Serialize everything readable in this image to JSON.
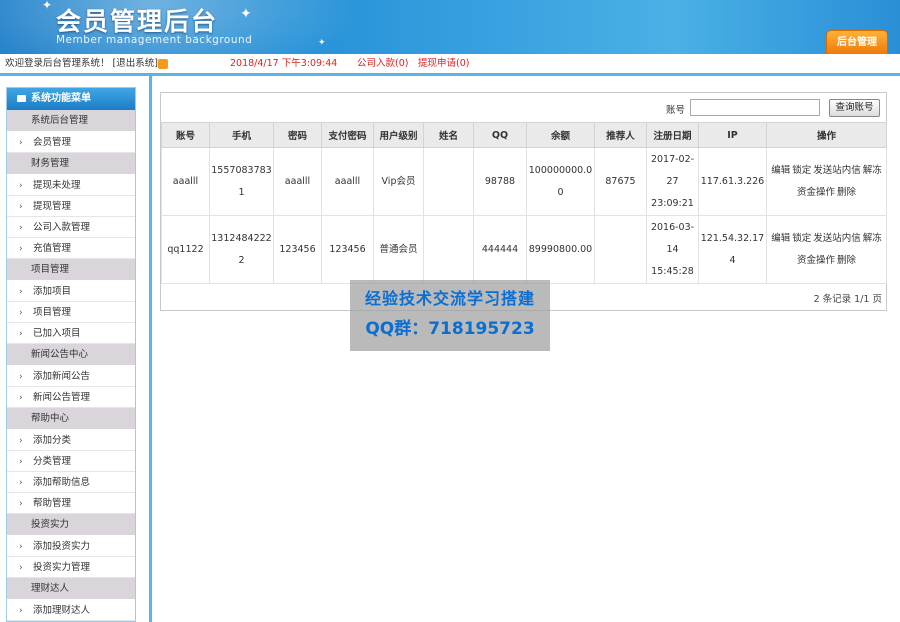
{
  "header": {
    "title": "会员管理后台",
    "subtitle": "Member management background",
    "admin_tab": "后台管理"
  },
  "statusbar": {
    "welcome": "欢迎登录后台管理系统！ [退出系统]",
    "time": "2018/4/17 下午3:09:44",
    "deposits": "公司入款(0)",
    "withdrawals": "提现申请(0)"
  },
  "sidebar": {
    "title": "系统功能菜单",
    "entries": [
      {
        "type": "group",
        "label": "系统后台管理"
      },
      {
        "type": "item",
        "label": "会员管理"
      },
      {
        "type": "group",
        "label": "财务管理"
      },
      {
        "type": "item",
        "label": "提现未处理"
      },
      {
        "type": "item",
        "label": "提现管理"
      },
      {
        "type": "item",
        "label": "公司入款管理"
      },
      {
        "type": "item",
        "label": "充值管理"
      },
      {
        "type": "group",
        "label": "项目管理"
      },
      {
        "type": "item",
        "label": "添加项目"
      },
      {
        "type": "item",
        "label": "项目管理"
      },
      {
        "type": "item",
        "label": "已加入项目"
      },
      {
        "type": "group",
        "label": "新闻公告中心"
      },
      {
        "type": "item",
        "label": "添加新闻公告"
      },
      {
        "type": "item",
        "label": "新闻公告管理"
      },
      {
        "type": "group",
        "label": "帮助中心"
      },
      {
        "type": "item",
        "label": "添加分类"
      },
      {
        "type": "item",
        "label": "分类管理"
      },
      {
        "type": "item",
        "label": "添加帮助信息"
      },
      {
        "type": "item",
        "label": "帮助管理"
      },
      {
        "type": "group",
        "label": "投资实力"
      },
      {
        "type": "item",
        "label": "添加投资实力"
      },
      {
        "type": "item",
        "label": "投资实力管理"
      },
      {
        "type": "group",
        "label": "理财达人"
      },
      {
        "type": "item",
        "label": "添加理财达人"
      }
    ]
  },
  "search": {
    "label": "账号",
    "value": "",
    "placeholder": "",
    "button": "查询账号"
  },
  "table": {
    "columns": [
      "账号",
      "手机",
      "密码",
      "支付密码",
      "用户级别",
      "姓名",
      "QQ",
      "余额",
      "推荐人",
      "注册日期",
      "IP",
      "操作"
    ],
    "rows": [
      [
        "aaalll",
        "15570837831",
        "aaalll",
        "aaalll",
        "Vip会员",
        "",
        "98788",
        "100000000.00",
        "87675",
        "2017-02-\n27\n23:09:21",
        "117.61.3.226",
        ""
      ],
      [
        "qq1122",
        "13124842222",
        "123456",
        "123456",
        "普通会员",
        "",
        "444444",
        "89990800.00",
        "",
        "2016-03-\n14\n15:45:28",
        "121.54.32.174",
        ""
      ]
    ],
    "actions": [
      "编辑",
      "锁定",
      "发送站内信",
      "解冻",
      "资金操作",
      "删除"
    ]
  },
  "pager": "2 条记录 1/1 页",
  "watermark": {
    "line1": "经验技术交流学习搭建",
    "line2": "QQ群：718195723"
  }
}
